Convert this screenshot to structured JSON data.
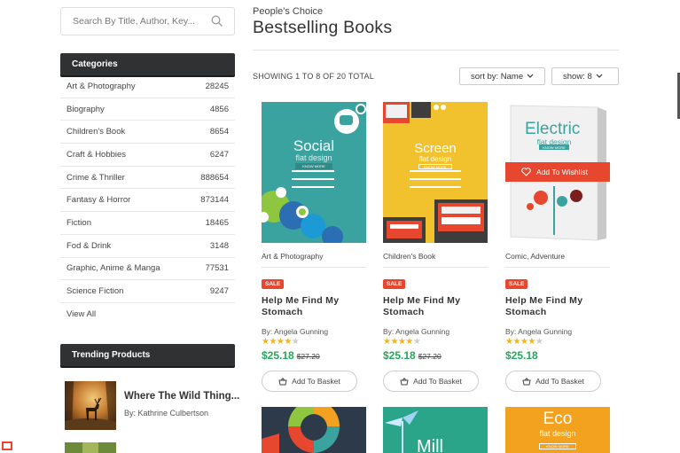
{
  "search": {
    "placeholder": "Search By Title, Author, Key..."
  },
  "sidebar": {
    "categories_header": "Categories",
    "categories": [
      {
        "name": "Art & Photography",
        "count": "28245"
      },
      {
        "name": "Biography",
        "count": "4856"
      },
      {
        "name": "Children's Book",
        "count": "8654"
      },
      {
        "name": "Craft & Hobbies",
        "count": "6247"
      },
      {
        "name": "Crime & Thriller",
        "count": "888654"
      },
      {
        "name": "Fantasy & Horror",
        "count": "873144"
      },
      {
        "name": "Fiction",
        "count": "18465"
      },
      {
        "name": "Fod & Drink",
        "count": "3148"
      },
      {
        "name": "Graphic, Anime & Manga",
        "count": "77531"
      },
      {
        "name": "Science Fiction",
        "count": "9247"
      }
    ],
    "view_all": "View All",
    "trending_header": "Trending Products",
    "trending": [
      {
        "title": "Where The Wild Thing...",
        "author": "By: Kathrine Culbertson"
      }
    ]
  },
  "main": {
    "subtitle": "People's Choice",
    "title": "Bestselling Books",
    "showing": "SHOWING 1 TO 8 OF 20 TOTAL",
    "sort_label": "sort by: Name",
    "show_label": "show: 8",
    "wishlist_label": "Add To Wishlist",
    "products": [
      {
        "cover_title": "Social",
        "cover_sub": "flat design",
        "cover_btn": "KNOW MORE",
        "category": "Art & Photography",
        "badge": "SALE",
        "title_line1": "Help Me Find My",
        "title_line2": "Stomach",
        "author": "By: Angela Gunning",
        "rating": 4,
        "rating_max": 5,
        "price": "$25.18",
        "old_price": "$27.20",
        "button": "Add To Basket"
      },
      {
        "cover_title": "Screen",
        "cover_sub": "flat design",
        "cover_btn": "KNOW MORE",
        "category": "Children's Book",
        "badge": "SALE",
        "title_line1": "Help Me Find My",
        "title_line2": "Stomach",
        "author": "By: Angela Gunning",
        "rating": 4,
        "rating_max": 5,
        "price": "$25.18",
        "old_price": "$27.20",
        "button": "Add To Basket"
      },
      {
        "cover_title": "Electric",
        "cover_sub": "flat design",
        "cover_btn": "KNOW MORE",
        "category": "Comic, Adventure",
        "badge": "SALE",
        "title_line1": "Help Me Find My",
        "title_line2": "Stomach",
        "author": "By: Angela Gunning",
        "rating": 4,
        "rating_max": 5,
        "price": "$25.18",
        "old_price": "",
        "button": "Add To Basket"
      }
    ],
    "next_row": [
      {
        "cover_title": ""
      },
      {
        "cover_title": "Mill"
      },
      {
        "cover_title": "Eco",
        "cover_sub": "flat design",
        "cover_btn": "KNOW MORE"
      }
    ]
  },
  "colors": {
    "accent": "#e8472f",
    "price_green": "#27a55b",
    "star": "#f5b31b",
    "dark_header": "#2f3133",
    "cover_teal": "#3aa3a0",
    "cover_yellow": "#f2c12e",
    "cover_orange": "#f2a21f"
  }
}
